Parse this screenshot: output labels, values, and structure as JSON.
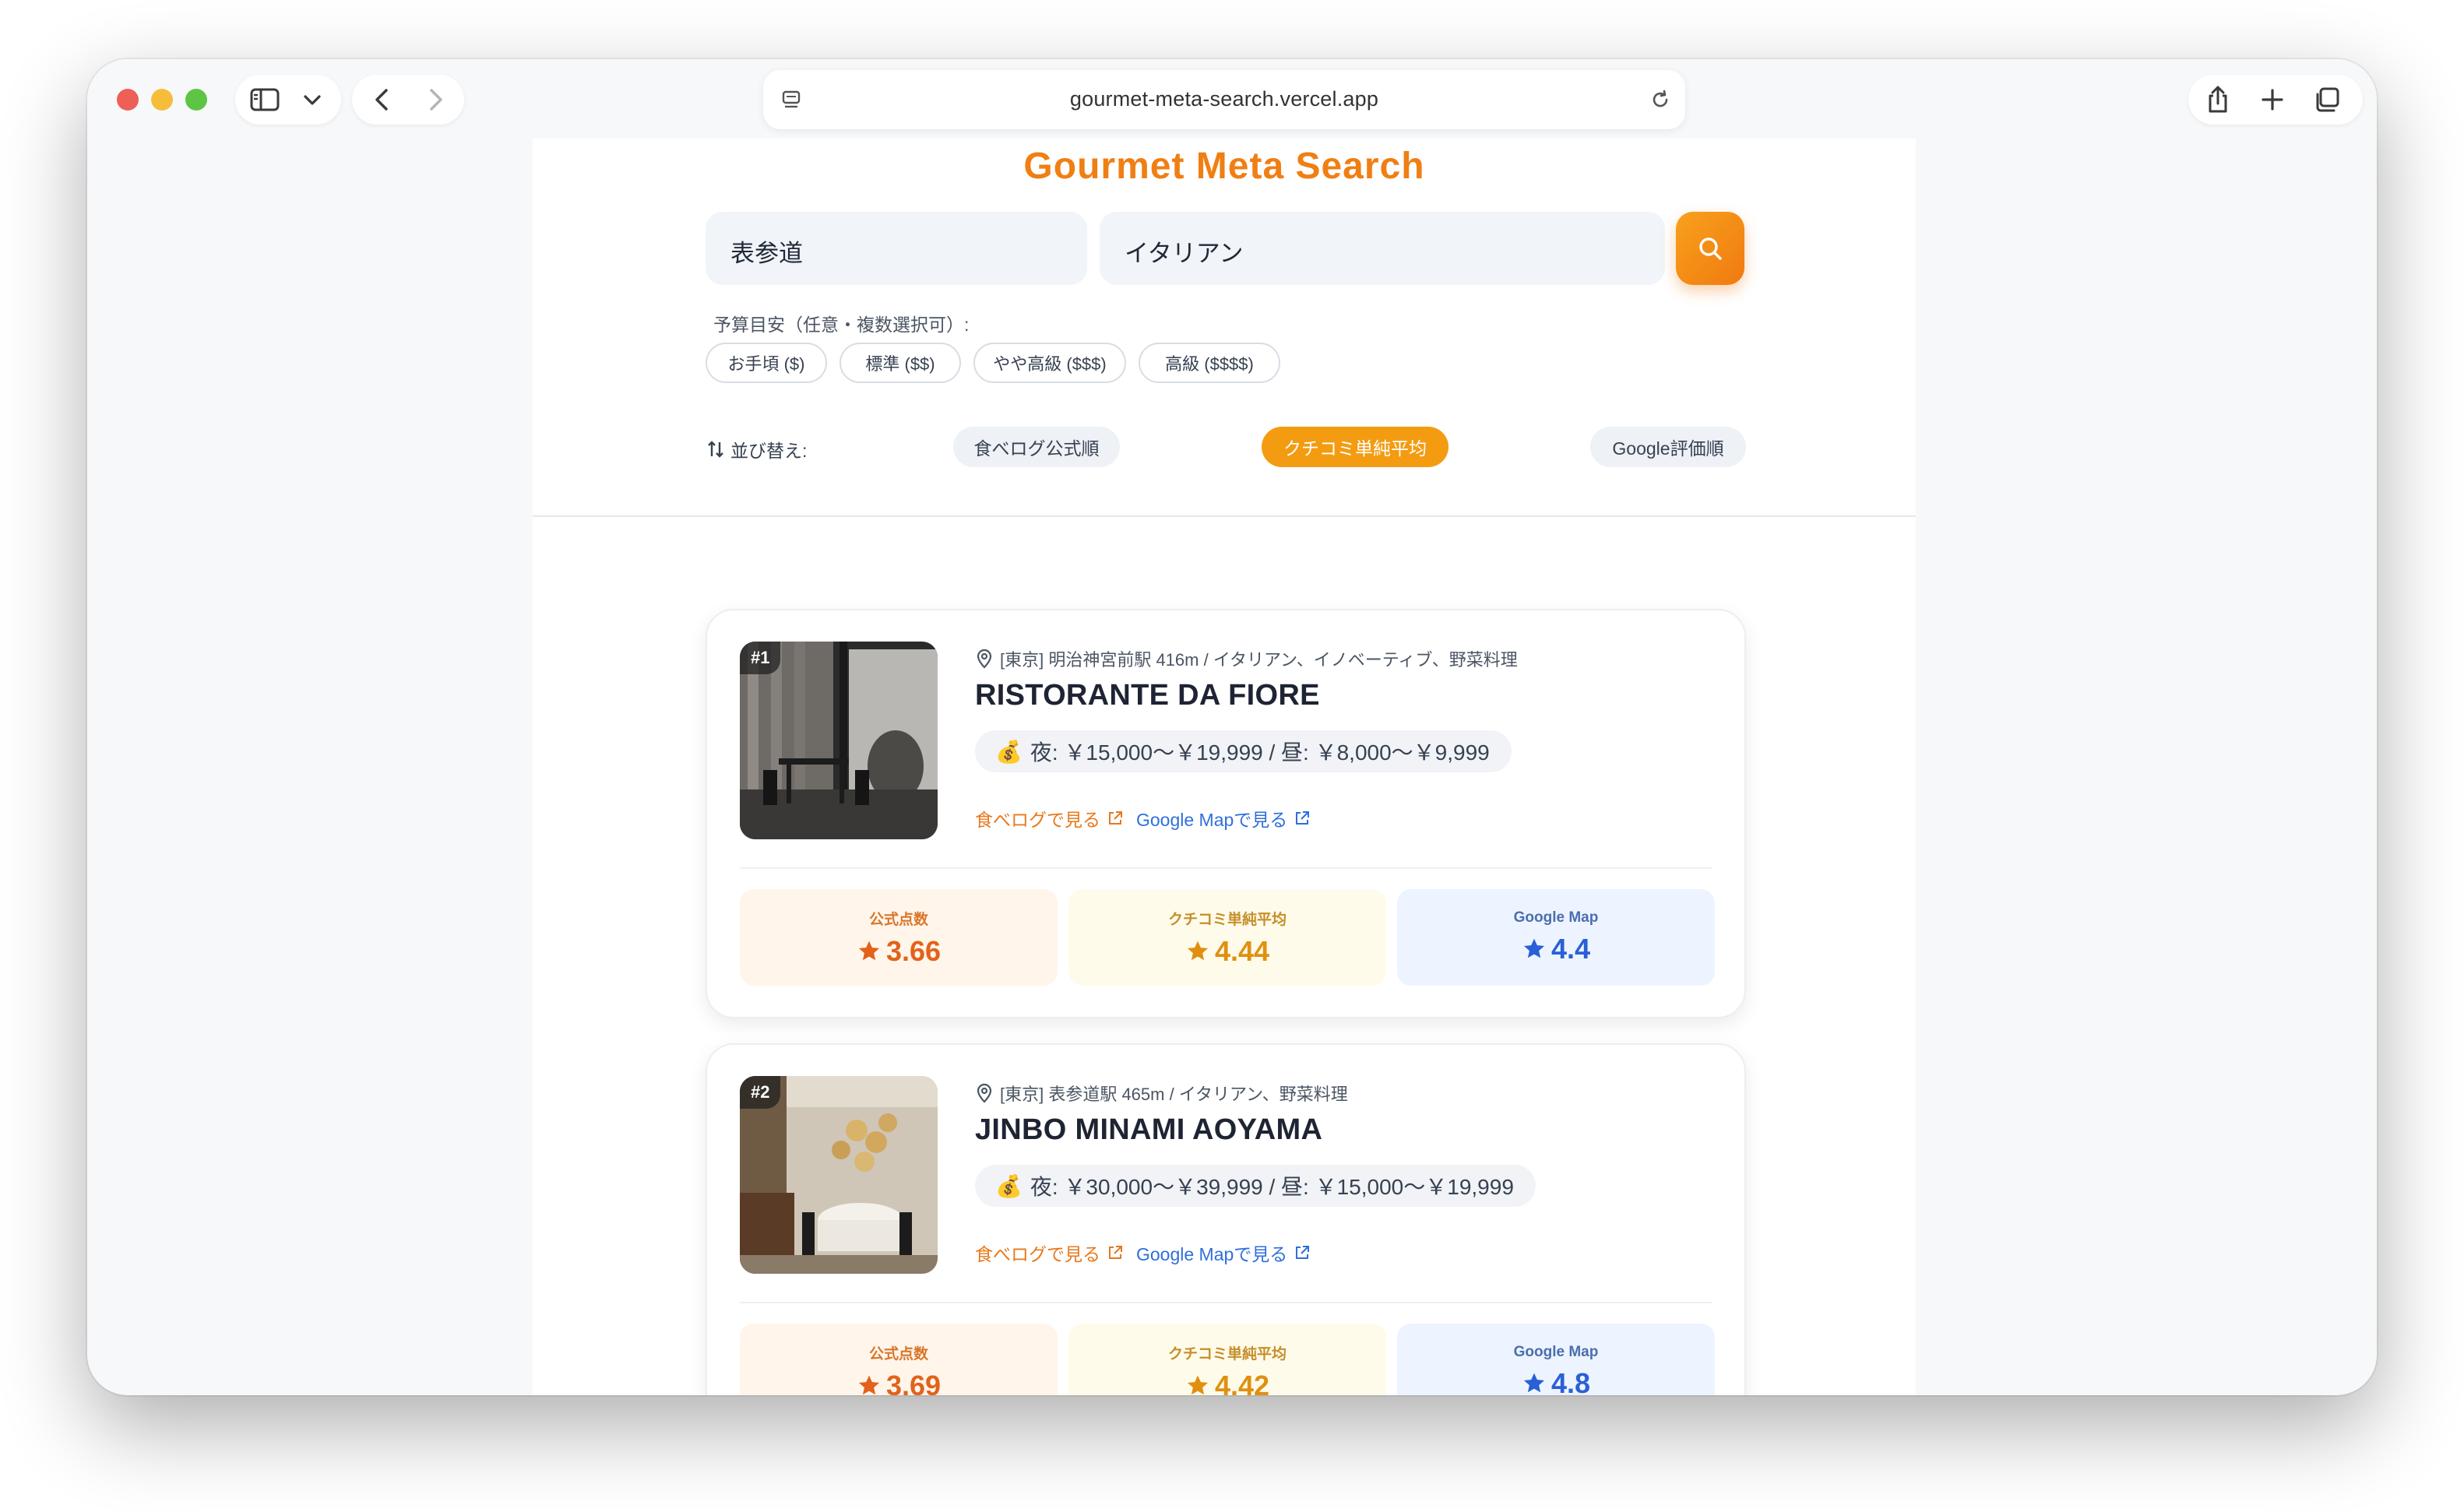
{
  "browser": {
    "url": "gourmet-meta-search.vercel.app"
  },
  "app": {
    "title": "Gourmet Meta Search"
  },
  "search": {
    "area_value": "表参道",
    "keyword_value": "イタリアン"
  },
  "budget": {
    "label": "予算目安（任意・複数選択可）:",
    "options": [
      "お手頃 ($)",
      "標準 ($$)",
      "やや高級 ($$$)",
      "高級 ($$$$)"
    ]
  },
  "sort": {
    "label": "並び替え:",
    "options": [
      "食べログ公式順",
      "クチコミ単純平均",
      "Google評価順"
    ],
    "active": "クチコミ単純平均"
  },
  "results": [
    {
      "rank": "#1",
      "location": "[東京] 明治神宮前駅 416m / イタリアン、イノベーティブ、野菜料理",
      "name": "RISTORANTE DA FIORE",
      "price": "夜: ￥15,000～￥19,999 / 昼: ￥8,000～￥9,999",
      "tabelog_link": "食べログで見る",
      "google_link": "Google Mapで見る",
      "scores": {
        "official_label": "公式点数",
        "official": "3.66",
        "review_label": "クチコミ単純平均",
        "review": "4.44",
        "google_label": "Google Map",
        "google": "4.4"
      }
    },
    {
      "rank": "#2",
      "location": "[東京] 表参道駅 465m / イタリアン、野菜料理",
      "name": "JINBO MINAMI AOYAMA",
      "price": "夜: ￥30,000～￥39,999 / 昼: ￥15,000～￥19,999",
      "tabelog_link": "食べログで見る",
      "google_link": "Google Mapで見る",
      "scores": {
        "official_label": "公式点数",
        "official": "3.69",
        "review_label": "クチコミ単純平均",
        "review": "4.42",
        "google_label": "Google Map",
        "google": "4.8"
      }
    }
  ],
  "colors": {
    "brand": "#f07f13",
    "active_sort": "#f39c12",
    "google_blue": "#2a60d6"
  }
}
